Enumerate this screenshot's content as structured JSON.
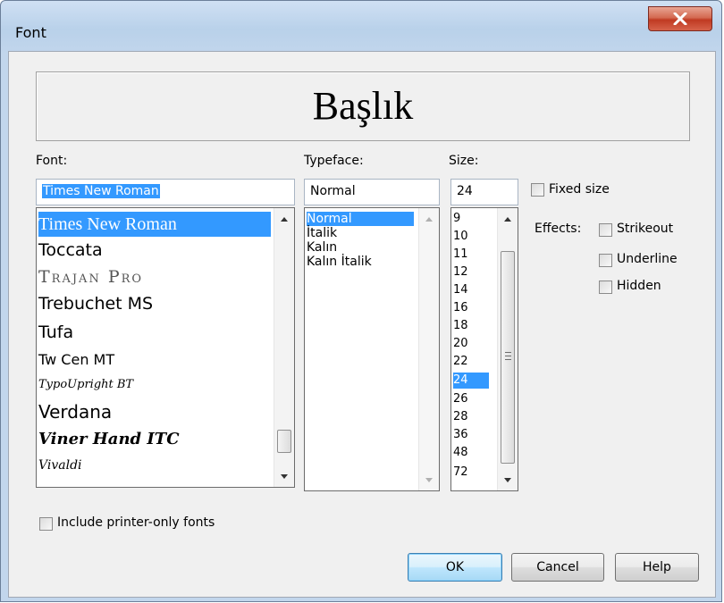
{
  "window": {
    "title": "Font"
  },
  "preview": {
    "text": "Başlık"
  },
  "font": {
    "label": "Font:",
    "value": "Times New Roman",
    "items": [
      "Times New Roman",
      "Toccata",
      "Trajan Pro",
      "Trebuchet MS",
      "Tufa",
      "Tw Cen MT",
      "TypoUpright BT",
      "Verdana",
      "Viner Hand ITC",
      "Vivaldi"
    ],
    "selected": "Times New Roman"
  },
  "typeface": {
    "label": "Typeface:",
    "value": "Normal",
    "items": [
      "Normal",
      "İtalik",
      "Kalın",
      "Kalın İtalik"
    ],
    "selected": "Normal"
  },
  "size": {
    "label": "Size:",
    "value": "24",
    "items": [
      "9",
      "10",
      "11",
      "12",
      "14",
      "16",
      "18",
      "20",
      "22",
      "24",
      "26",
      "28",
      "36",
      "48",
      "72"
    ],
    "selected": "24"
  },
  "options": {
    "fixed_size": "Fixed size",
    "effects_label": "Effects:",
    "strikeout": "Strikeout",
    "underline": "Underline",
    "hidden": "Hidden",
    "printer_fonts": "Include printer-only fonts"
  },
  "buttons": {
    "ok": "OK",
    "cancel": "Cancel",
    "help": "Help"
  },
  "colors": {
    "selection": "#3399ff",
    "close_button": "#c8432b",
    "dialog_bg": "#f0f0f0"
  }
}
